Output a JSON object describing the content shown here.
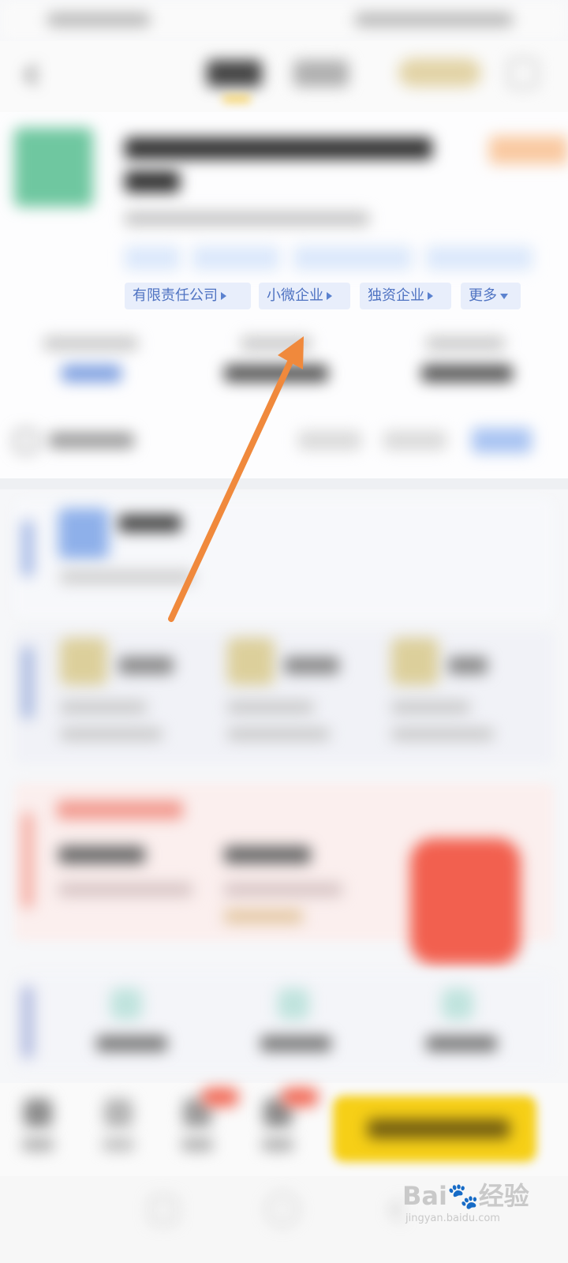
{
  "colors": {
    "tag_text": "#4f73c2",
    "tag_bg": "#e8eefb",
    "arrow": "#f0893c",
    "cta_yellow": "#f6cf17",
    "logo_green": "#6fc7a0"
  },
  "company": {
    "tags": [
      {
        "label": "有限责任公司",
        "icon": "triangle-right-icon"
      },
      {
        "label": "小微企业",
        "icon": "triangle-right-icon"
      },
      {
        "label": "独资企业",
        "icon": "triangle-right-icon"
      },
      {
        "label": "更多",
        "icon": "triangle-down-icon"
      }
    ]
  },
  "annotation": {
    "icon": "arrow-annotation-icon"
  },
  "watermark": {
    "brand_prefix": "Bai",
    "brand_paw": "🐾",
    "brand_suffix": "经验",
    "domain": "jingyan.baidu.com"
  }
}
